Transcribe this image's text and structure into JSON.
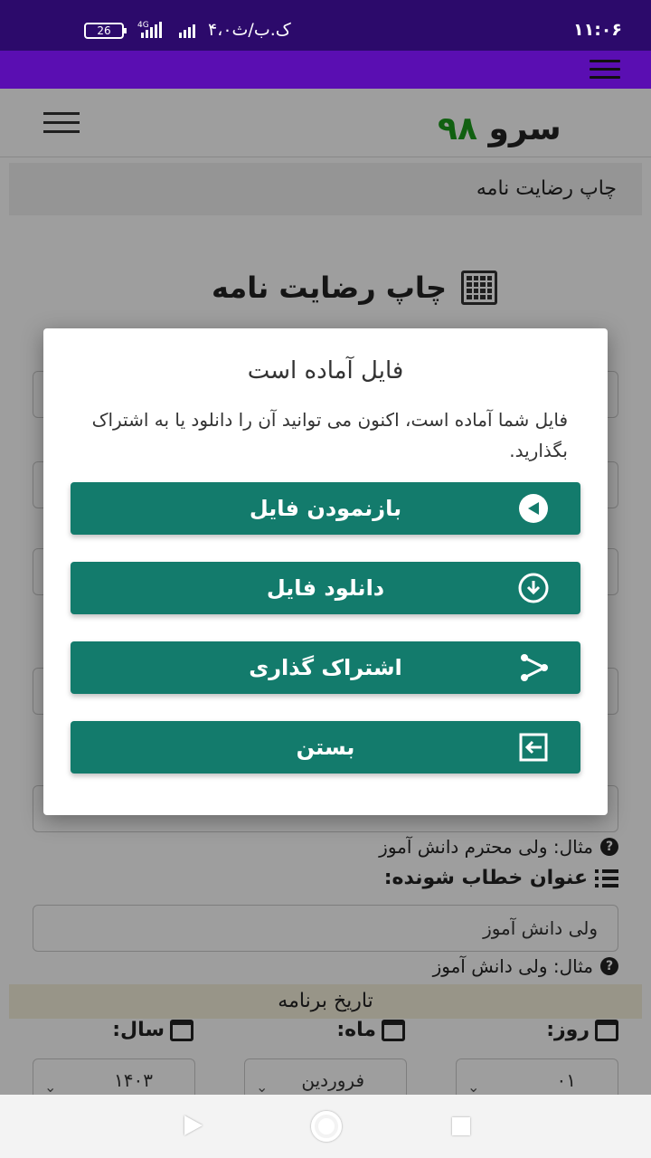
{
  "status_bar": {
    "time": "۱۱:۰۶",
    "carrier": "۴،۰ک.ب/ث",
    "network": "4G",
    "battery": "26"
  },
  "header": {
    "brand_word": "سرو",
    "brand_number": "۹۸",
    "menu_icon": "hamburger-icon"
  },
  "breadcrumb": "چاپ رضایت نامه",
  "page_title": "چاپ رضایت نامه",
  "form": {
    "hint_top": "مثال: ولی محترم دانش آموز",
    "addressee_label": "عنوان خطاب شونده:",
    "addressee_value": "ولی دانش آموز",
    "addressee_hint": "مثال: ولی دانش آموز",
    "date_section": "تاریخ برنامه",
    "day_label": "روز:",
    "month_label": "ماه:",
    "year_label": "سال:",
    "day_value": "۰۱",
    "month_value": "فروردین",
    "year_value": "۱۴۰۳"
  },
  "modal": {
    "title": "فایل آماده است",
    "body": "فایل شما آماده است، اکنون می توانید آن را دانلود یا به اشتراک بگذارید.",
    "buttons": [
      {
        "label": "بازنمودن فایل",
        "icon": "play-circle-icon"
      },
      {
        "label": "دانلود فایل",
        "icon": "download-circle-icon"
      },
      {
        "label": "اشتراک گذاری",
        "icon": "share-icon"
      },
      {
        "label": "بستن",
        "icon": "exit-icon"
      }
    ]
  },
  "colors": {
    "status_bar": "#2c0a6b",
    "topbar": "#5a0eb2",
    "button": "#137b6c",
    "brand_number": "#1c9b1c"
  }
}
